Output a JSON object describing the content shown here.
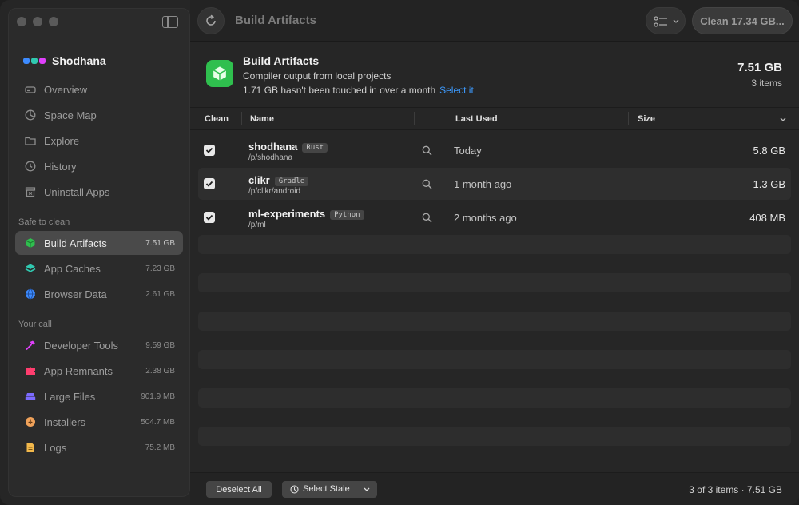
{
  "app": {
    "name": "Shodhana"
  },
  "colors": {
    "accent": "#3d9bff",
    "build": "#2fbf4e",
    "caches": "#30c9b0",
    "browser": "#3d8bff",
    "dev": "#e040fb",
    "remnants": "#ff3d6e",
    "large": "#7c6bff",
    "installers": "#f0a25a",
    "logs": "#f2b84b"
  },
  "sidebar": {
    "nav": [
      {
        "label": "Overview",
        "icon": "drive-icon"
      },
      {
        "label": "Space Map",
        "icon": "pie-icon"
      },
      {
        "label": "Explore",
        "icon": "folder-icon"
      },
      {
        "label": "History",
        "icon": "history-icon"
      },
      {
        "label": "Uninstall Apps",
        "icon": "trash-box-icon"
      }
    ],
    "safe_label": "Safe to clean",
    "safe": [
      {
        "label": "Build Artifacts",
        "size": "7.51 GB",
        "icon": "cube-icon"
      },
      {
        "label": "App Caches",
        "size": "7.23 GB",
        "icon": "layers-icon"
      },
      {
        "label": "Browser Data",
        "size": "2.61 GB",
        "icon": "globe-icon"
      }
    ],
    "call_label": "Your call",
    "call": [
      {
        "label": "Developer Tools",
        "size": "9.59 GB",
        "icon": "hammer-icon"
      },
      {
        "label": "App Remnants",
        "size": "2.38 GB",
        "icon": "puzzle-icon"
      },
      {
        "label": "Large Files",
        "size": "901.9 MB",
        "icon": "stack-icon"
      },
      {
        "label": "Installers",
        "size": "504.7 MB",
        "icon": "download-icon"
      },
      {
        "label": "Logs",
        "size": "75.2 MB",
        "icon": "doc-icon"
      }
    ]
  },
  "topbar": {
    "title": "Build Artifacts",
    "clean_label": "Clean 17.34 GB..."
  },
  "header": {
    "title": "Build Artifacts",
    "subtitle": "Compiler output from local projects",
    "stale_text": "1.71 GB hasn't been touched in over a month",
    "select_link": "Select it",
    "total": "7.51 GB",
    "count": "3 items"
  },
  "table": {
    "columns": {
      "clean": "Clean",
      "name": "Name",
      "last_used": "Last Used",
      "size": "Size"
    },
    "rows": [
      {
        "name": "shodhana",
        "tag": "Rust",
        "path": "/p/shodhana",
        "last_used": "Today",
        "size": "5.8 GB"
      },
      {
        "name": "clikr",
        "tag": "Gradle",
        "path": "/p/clikr/android",
        "last_used": "1 month ago",
        "size": "1.3 GB"
      },
      {
        "name": "ml-experiments",
        "tag": "Python",
        "path": "/p/ml",
        "last_used": "2 months ago",
        "size": "408 MB"
      }
    ]
  },
  "footer": {
    "deselect": "Deselect All",
    "select_stale": "Select Stale",
    "status": "3 of 3 items · 7.51 GB"
  }
}
